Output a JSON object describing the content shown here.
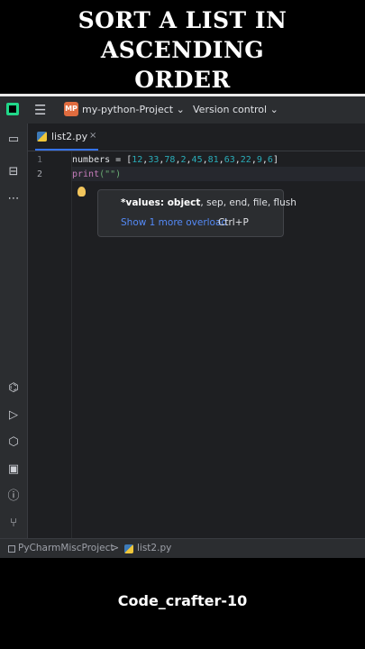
{
  "headline": {
    "line1": "SORT A LIST IN ASCENDING",
    "line2": "ORDER"
  },
  "topbar": {
    "project_badge": "MP",
    "project_name": "my-python-Project ⌄",
    "version_control": "Version control ⌄"
  },
  "tabs": [
    {
      "label": "list2.py",
      "close": "×"
    }
  ],
  "editor": {
    "line_numbers": [
      "1",
      "2"
    ],
    "line1": {
      "var": "numbers",
      "op": " = [",
      "nums": [
        "12",
        "33",
        "78",
        "2",
        "45",
        "81",
        "63",
        "22",
        "9",
        "6"
      ],
      "close": "]"
    },
    "line2": {
      "func": "print",
      "args": "(\"\")"
    }
  },
  "popup": {
    "signature_bold": "*values: object",
    "signature_rest": ", sep, end, file, flush",
    "overload_link": "Show 1 more overload",
    "shortcut": "Ctrl+P"
  },
  "statusbar": {
    "project": "PyCharmMiscProject",
    "separator": ">",
    "file": "list2.py"
  },
  "watermark": "Code_crafter-10",
  "colors": {
    "accent": "#3574f0",
    "number": "#2aacb8",
    "keyword": "#c77dbb",
    "string": "#6aab73",
    "bg": "#1e1f22"
  }
}
